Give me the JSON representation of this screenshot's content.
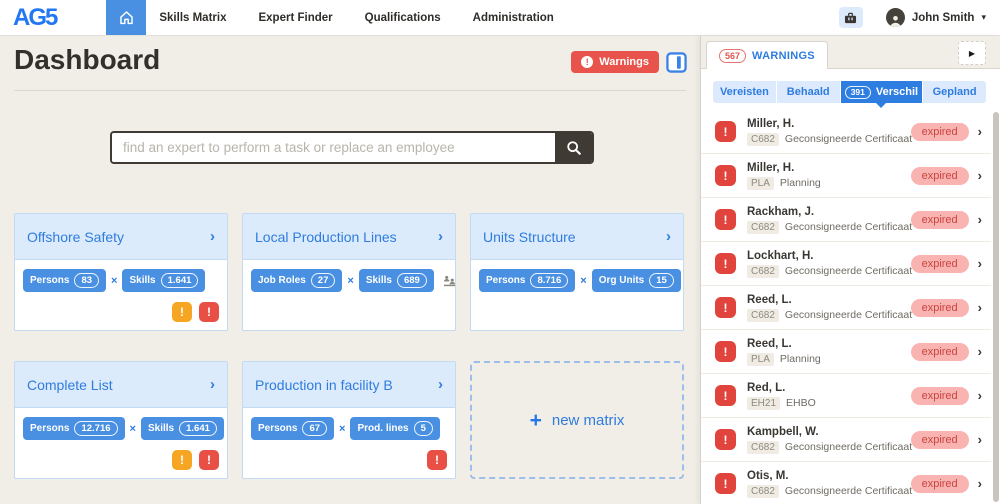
{
  "colors": {
    "brand_blue": "#2277f5",
    "primary_blue": "#4a90e2",
    "link_blue": "#2e7cdf",
    "active_segment_blue": "#2e7de0",
    "red": "#e85046",
    "orange": "#f6a623",
    "beige_background": "#f1eee7",
    "expired_badge_bg": "#f9b3b1",
    "expired_badge_text": "#c9453f"
  },
  "icons": {
    "exclamation": "!",
    "chevron_right": "›",
    "times": "×",
    "plus": "+",
    "caret_down": "▾",
    "collapse_arrow": "▶"
  },
  "navbar": {
    "logo": "AG5",
    "items": [
      "Skills Matrix",
      "Expert Finder",
      "Qualifications",
      "Administration"
    ],
    "user_name": "John Smith"
  },
  "header": {
    "title": "Dashboard",
    "warnings_button": "Warnings"
  },
  "search": {
    "placeholder": "find an expert to perform a task or replace an employee"
  },
  "matrices": [
    {
      "title": "Offshore Safety",
      "pills": [
        {
          "label": "Persons",
          "count": "83"
        },
        {
          "label": "Skills",
          "count": "1.641"
        }
      ]
    },
    {
      "title": "Local Production Lines",
      "pills": [
        {
          "label": "Job Roles",
          "count": "27"
        },
        {
          "label": "Skills",
          "count": "689"
        }
      ]
    },
    {
      "title": "Units Structure",
      "pills": [
        {
          "label": "Persons",
          "count": "8.716"
        },
        {
          "label": "Org Units",
          "count": "15"
        }
      ]
    },
    {
      "title": "Complete List",
      "pills": [
        {
          "label": "Persons",
          "count": "12.716"
        },
        {
          "label": "Skills",
          "count": "1.641"
        }
      ]
    },
    {
      "title": "Production in facility B",
      "pills": [
        {
          "label": "Persons",
          "count": "67"
        },
        {
          "label": "Prod. lines",
          "count": "5"
        }
      ]
    }
  ],
  "new_matrix": {
    "label": "new matrix"
  },
  "sidebar": {
    "tab": {
      "count": "567",
      "label": "WARNINGS"
    },
    "filters": [
      {
        "label": "Vereisten"
      },
      {
        "label": "Behaald"
      },
      {
        "label": "Verschil",
        "count": "391",
        "active": true
      },
      {
        "label": "Gepland"
      }
    ],
    "warnings": [
      {
        "name": "Miller, H.",
        "code": "C682",
        "desc": "Geconsigneerde Certificaat",
        "status": "expired"
      },
      {
        "name": "Miller, H.",
        "code": "PLA",
        "desc": "Planning",
        "status": "expired"
      },
      {
        "name": "Rackham, J.",
        "code": "C682",
        "desc": "Geconsigneerde Certificaat",
        "status": "expired"
      },
      {
        "name": "Lockhart, H.",
        "code": "C682",
        "desc": "Geconsigneerde Certificaat",
        "status": "expired"
      },
      {
        "name": "Reed, L.",
        "code": "C682",
        "desc": "Geconsigneerde Certificaat",
        "status": "expired"
      },
      {
        "name": "Reed, L.",
        "code": "PLA",
        "desc": "Planning",
        "status": "expired"
      },
      {
        "name": "Red, L.",
        "code": "EH21",
        "desc": "EHBO",
        "status": "expired"
      },
      {
        "name": "Kampbell, W.",
        "code": "C682",
        "desc": "Geconsigneerde Certificaat",
        "status": "expired"
      },
      {
        "name": "Otis, M.",
        "code": "C682",
        "desc": "Geconsigneerde Certificaat",
        "status": "expired"
      }
    ]
  }
}
